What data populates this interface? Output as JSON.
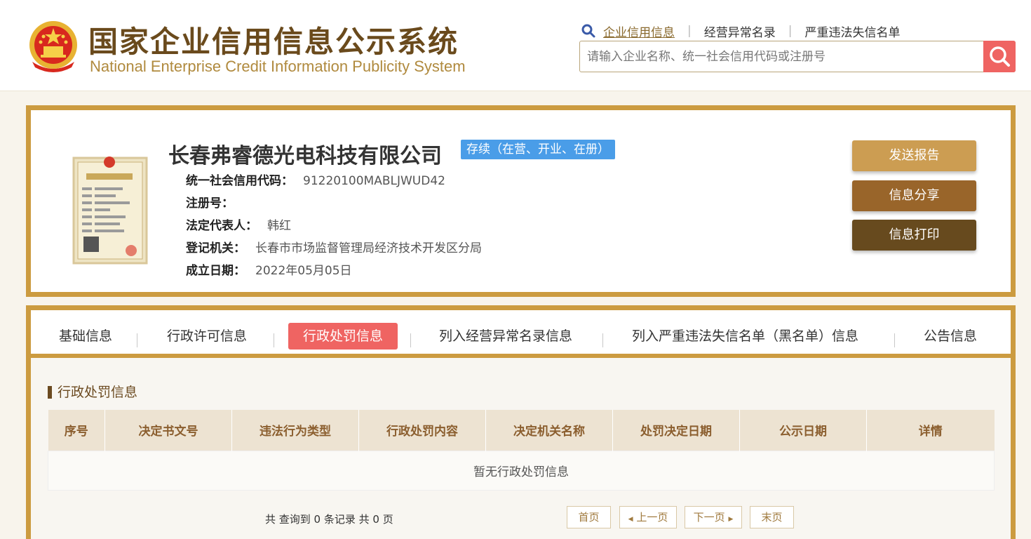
{
  "header": {
    "title_cn": "国家企业信用信息公示系统",
    "title_en": "National Enterprise Credit Information Publicity System",
    "emblem_icon": "national-emblem-icon",
    "nav": [
      "企业信用信息",
      "经营异常名录",
      "严重违法失信名单"
    ],
    "search_placeholder": "请输入企业名称、统一社会信用代码或注册号",
    "search_icon": "magnifier-icon"
  },
  "company": {
    "name": "长春弗睿德光电科技有限公司",
    "status": "存续（在营、开业、在册）",
    "credit_code_label": "统一社会信用代码：",
    "credit_code": "91220100MABLJWUD42",
    "reg_no_label": "注册号：",
    "reg_no": "",
    "legal_rep_label": "法定代表人：",
    "legal_rep": "韩红",
    "authority_label": "登记机关：",
    "authority": "长春市市场监督管理局经济技术开发区分局",
    "established_label": "成立日期：",
    "established": "2022年05月05日",
    "license_icon": "business-license-icon",
    "buttons": {
      "send_report": "发送报告",
      "share": "信息分享",
      "print": "信息打印"
    }
  },
  "tabs": [
    "基础信息",
    "行政许可信息",
    "行政处罚信息",
    "列入经营异常名录信息",
    "列入严重违法失信名单（黑名单）信息",
    "公告信息"
  ],
  "active_tab": "行政处罚信息",
  "section": {
    "title": "行政处罚信息",
    "columns": [
      "序号",
      "决定书文号",
      "违法行为类型",
      "行政处罚内容",
      "决定机关名称",
      "处罚决定日期",
      "公示日期",
      "详情"
    ],
    "empty_text": "暂无行政处罚信息"
  },
  "pagination": {
    "summary": "共 查询到 0 条记录 共 0 页",
    "first": "首页",
    "prev": "上一页",
    "next": "下一页",
    "last": "末页"
  },
  "colors": {
    "gold_border": "#cc9b40",
    "accent_red": "#ef6462",
    "status_blue": "#4a9de8",
    "brown_dark": "#674a1e"
  }
}
